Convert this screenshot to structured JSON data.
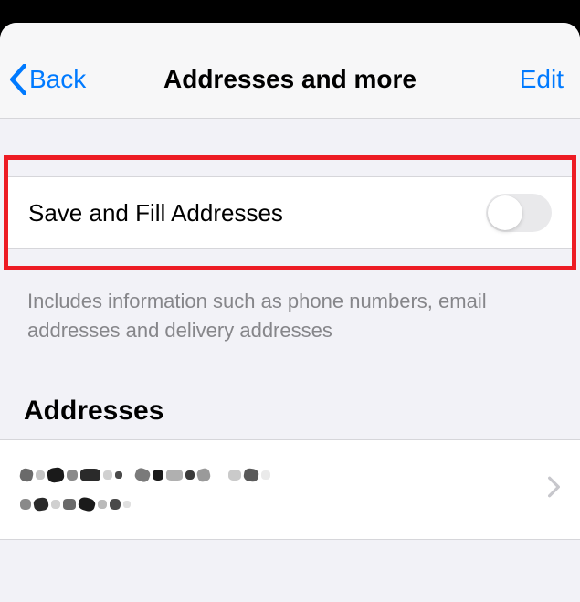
{
  "nav": {
    "back_label": "Back",
    "title": "Addresses and more",
    "edit_label": "Edit"
  },
  "toggle": {
    "label": "Save and Fill Addresses",
    "on": false
  },
  "footer_text": "Includes information such as phone numbers, email addresses and delivery addresses",
  "section": {
    "header": "Addresses"
  },
  "address_item": {
    "redacted": true
  },
  "colors": {
    "accent": "#007aff",
    "highlight_border": "#ed1c24"
  }
}
